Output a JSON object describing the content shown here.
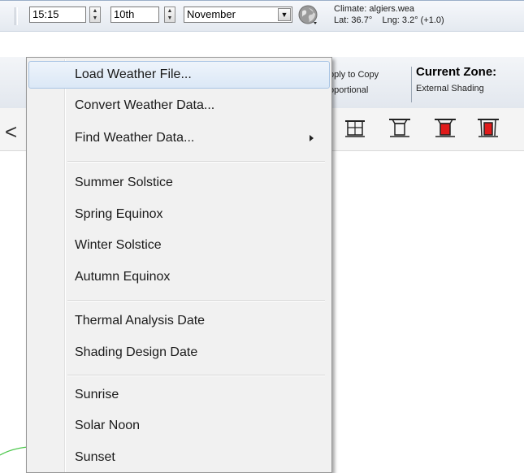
{
  "toolbar": {
    "time_value": "15:15",
    "day_value": "10th",
    "month_value": "November",
    "globe_icon": "globe-icon",
    "climate_file": "Climate: algiers.wea",
    "lat": "Lat: 36.7°",
    "lng": "Lng: 3.2° (+1.0)",
    "apply_partial_1": "pply to Copy",
    "apply_partial_2": "oportional",
    "current_zone_label": "Current Zone:",
    "shading_label": "External Shading",
    "shading_icons": [
      "shading-frame-icon",
      "shading-overhang-icon",
      "shading-red-overhang-icon",
      "shading-red-fin-icon"
    ]
  },
  "menu": {
    "groups": [
      [
        "Load Weather File...",
        "Convert Weather Data...",
        "Find Weather Data..."
      ],
      [
        "Summer Solstice",
        "Spring Equinox",
        "Winter Solstice",
        "Autumn Equinox"
      ],
      [
        "Thermal Analysis Date",
        "Shading Design Date"
      ],
      [
        "Sunrise",
        "Solar Noon",
        "Sunset"
      ]
    ],
    "highlighted": "Load Weather File..."
  },
  "colors": {
    "menu_background": "#f1f1f1",
    "highlight": "#dbe8f6",
    "shade_red": "#e01b1b",
    "plot_line_green": "#4cc84c"
  }
}
